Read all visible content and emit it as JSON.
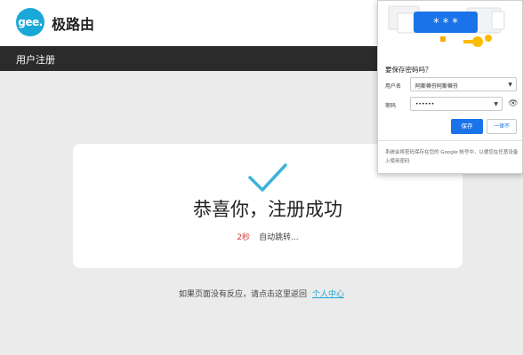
{
  "header": {
    "logo_text": "gee.",
    "brand_name": "极路由"
  },
  "nav": {
    "title": "用户注册"
  },
  "card": {
    "success_text": "恭喜你，注册成功",
    "countdown": "2秒",
    "redirect_text": "自动跳转..."
  },
  "footer": {
    "text": "如果页面没有反应，请点击这里返回",
    "link_text": "个人中心"
  },
  "save_password_popup": {
    "masked_illustration_text": "* * *",
    "title": "要保存密码吗？",
    "username_label": "用户名",
    "username_value": "阿斯蒂芬阿斯蒂芬",
    "password_label": "密码",
    "password_value": "••••••",
    "save_button": "保存",
    "never_button": "一律不",
    "footer_text": "系统会将密码保存在您的 Google 帐号中，以便您在任意设备上使用密码"
  },
  "colors": {
    "brand_blue": "#1aa8d8",
    "nav_bg": "#2b2b2b",
    "page_bg": "#ebebeb",
    "countdown_red": "#d23a3a",
    "chrome_blue": "#1a73e8"
  }
}
